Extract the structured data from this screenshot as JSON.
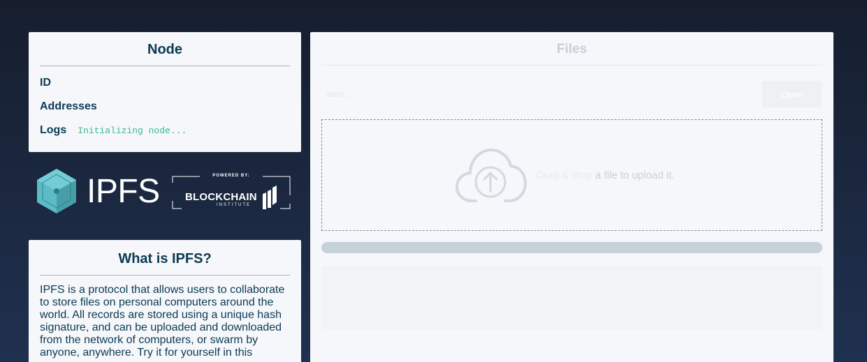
{
  "node": {
    "title": "Node",
    "id_label": "ID",
    "addresses_label": "Addresses",
    "logs_label": "Logs",
    "log_text": "Initializing node..."
  },
  "logos": {
    "ipfs_text": "IPFS",
    "powered_by": "POWERED BY:",
    "blockchain": "BLOCKCHAIN",
    "institute": "INSTITUTE"
  },
  "about": {
    "title": "What is IPFS?",
    "text": "IPFS is a protocol that allows users to collaborate to store files on personal computers around the world. All records are stored using a unique hash signature, and can be uploaded and downloaded from the network of computers, or swarm by anyone, anywhere. Try it for yourself in this"
  },
  "files": {
    "title": "Files",
    "hash_placeholder": "hash...",
    "open_label": "Open",
    "drag_link": "Drag & drop",
    "drag_rest": " a file to upload it."
  },
  "colors": {
    "background": "#1b2840",
    "panel": "#f5f7fa",
    "heading": "#0b3a53",
    "log_green": "#3fb797",
    "ipfs_teal": "#65c2cb"
  },
  "icons": {
    "ipfs_logo": "ipfs-cube-icon",
    "blockchain_logo": "blockchain-institute-icon",
    "upload": "cloud-upload-icon"
  }
}
